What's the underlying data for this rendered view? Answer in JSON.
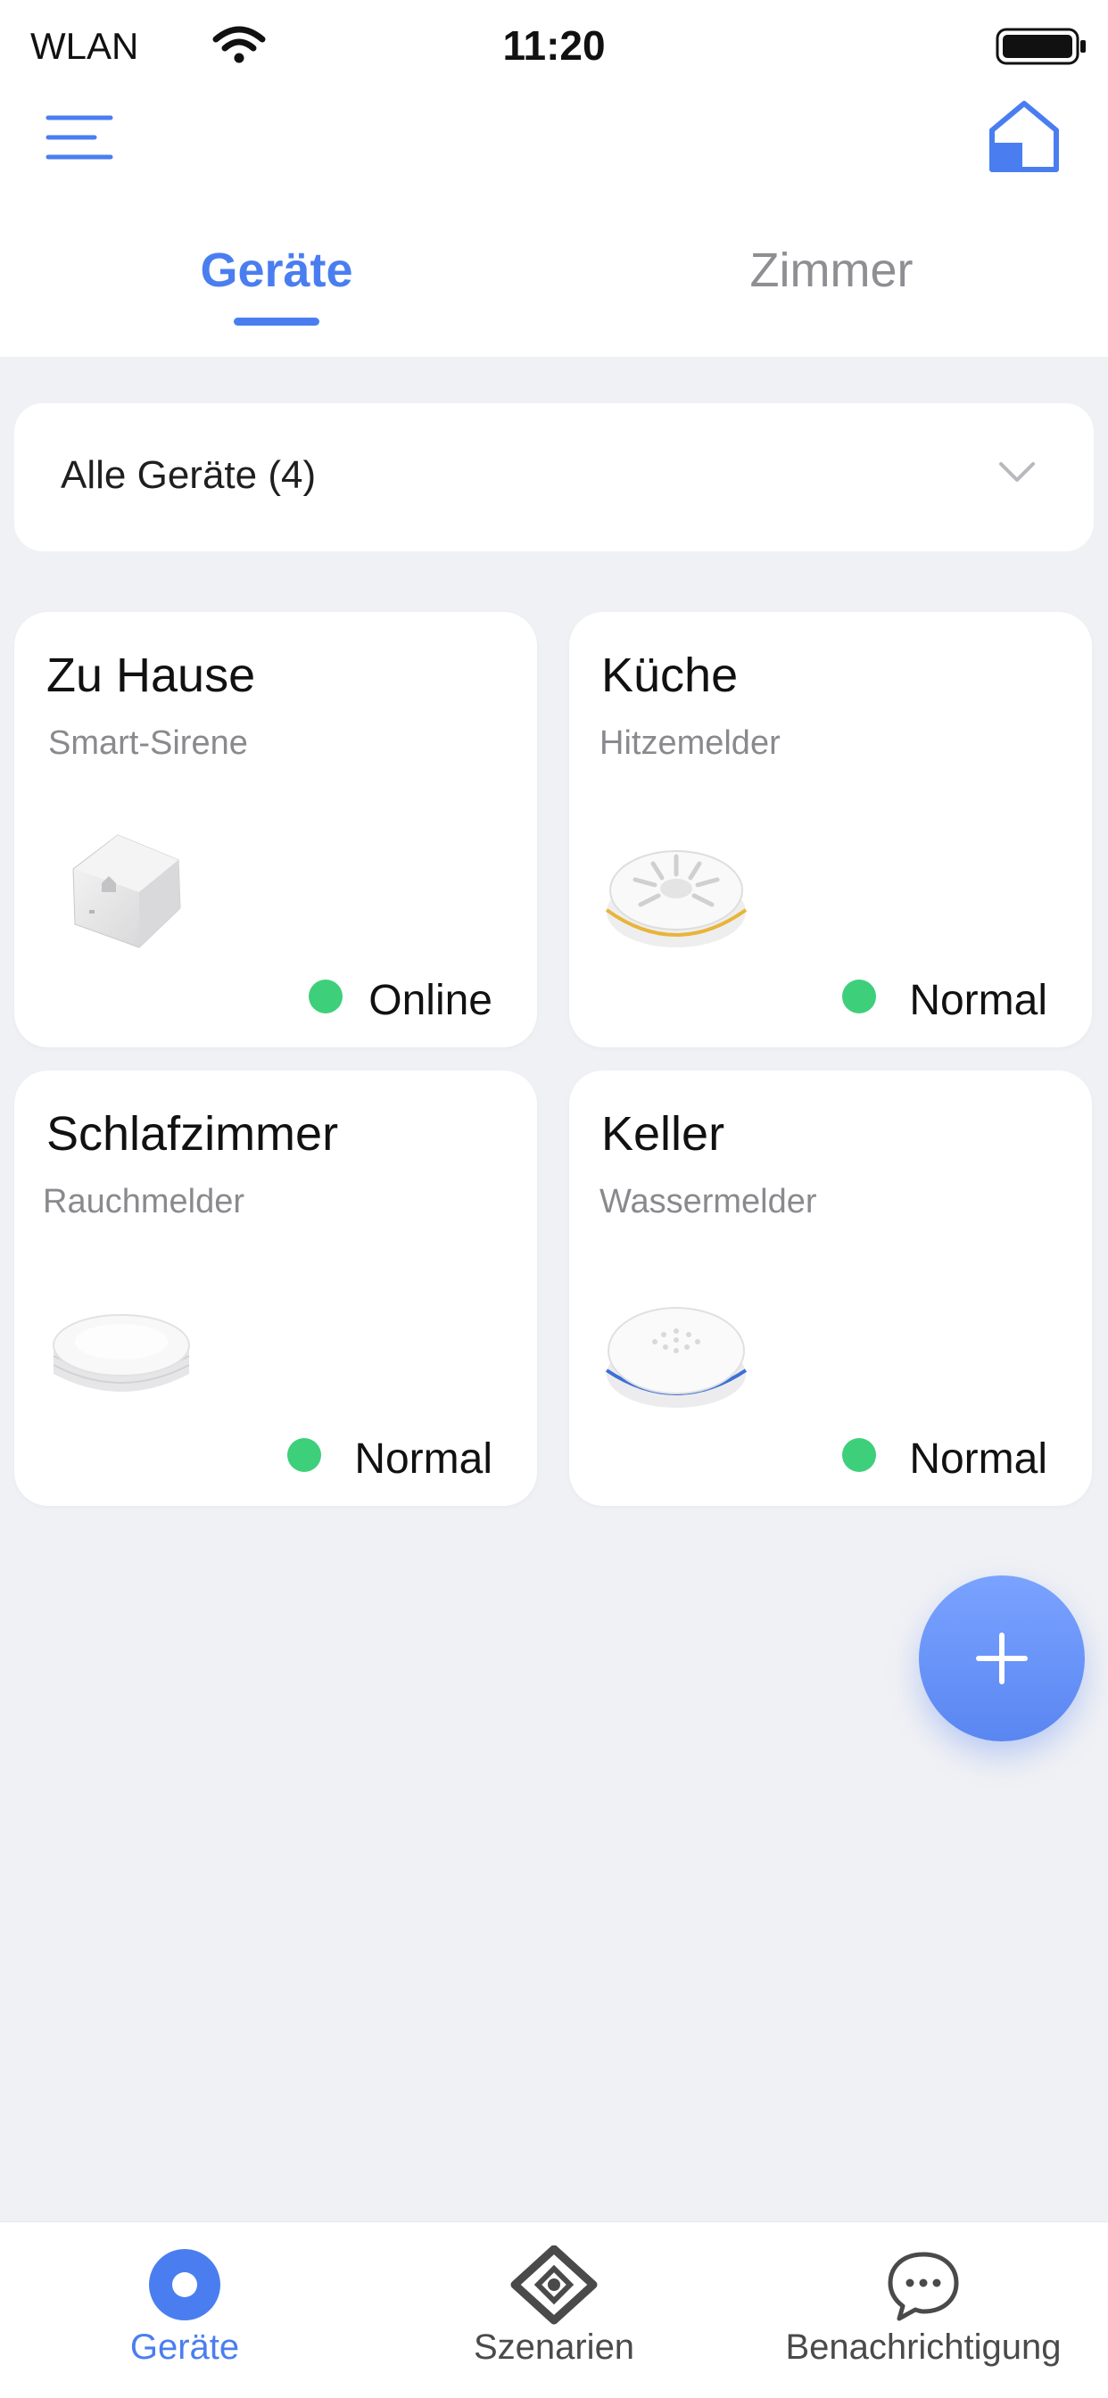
{
  "status_bar": {
    "carrier": "WLAN",
    "time": "11:20"
  },
  "tabs": [
    {
      "label": "Geräte",
      "active": true
    },
    {
      "label": "Zimmer",
      "active": false
    }
  ],
  "filter": {
    "label": "Alle Geräte (4)"
  },
  "devices": [
    {
      "room": "Zu Hause",
      "type": "Smart-Sirene",
      "status": "Online",
      "icon": "smart-siren-icon"
    },
    {
      "room": "Küche",
      "type": "Hitzemelder",
      "status": "Normal",
      "icon": "heat-detector-icon"
    },
    {
      "room": "Schlafzimmer",
      "type": "Rauchmelder",
      "status": "Normal",
      "icon": "smoke-detector-icon"
    },
    {
      "room": "Keller",
      "type": "Wassermelder",
      "status": "Normal",
      "icon": "water-detector-icon"
    }
  ],
  "bottom_nav": [
    {
      "label": "Geräte",
      "icon": "devices-icon",
      "active": true
    },
    {
      "label": "Szenarien",
      "icon": "scenarios-icon",
      "active": false
    },
    {
      "label": "Benachrichtigung",
      "icon": "notifications-icon",
      "active": false
    }
  ],
  "colors": {
    "accent": "#4a7ef0",
    "status_ok": "#3ecf7a",
    "background": "#f0f1f5"
  }
}
